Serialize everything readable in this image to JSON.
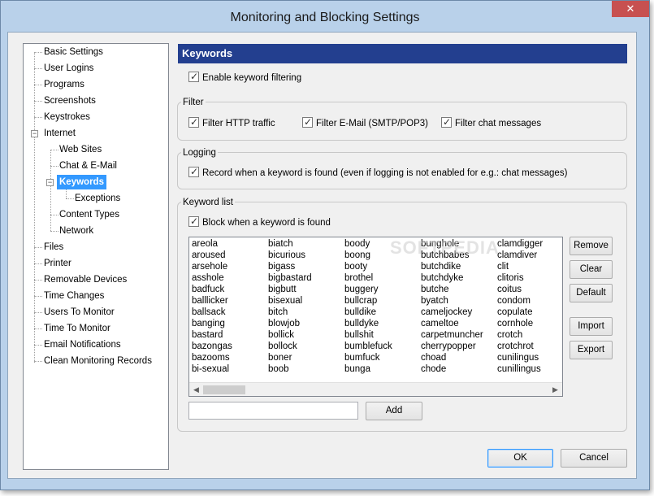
{
  "window": {
    "title": "Monitoring and Blocking Settings",
    "close_glyph": "✕"
  },
  "tree": {
    "items": [
      {
        "label": "Basic Settings"
      },
      {
        "label": "User Logins"
      },
      {
        "label": "Programs"
      },
      {
        "label": "Screenshots"
      },
      {
        "label": "Keystrokes"
      },
      {
        "label": "Internet"
      },
      {
        "label": "Web Sites"
      },
      {
        "label": "Chat & E-Mail"
      },
      {
        "label": "Keywords"
      },
      {
        "label": "Exceptions"
      },
      {
        "label": "Content Types"
      },
      {
        "label": "Network"
      },
      {
        "label": "Files"
      },
      {
        "label": "Printer"
      },
      {
        "label": "Removable Devices"
      },
      {
        "label": "Time Changes"
      },
      {
        "label": "Users To Monitor"
      },
      {
        "label": "Time To Monitor"
      },
      {
        "label": "Email Notifications"
      },
      {
        "label": "Clean Monitoring Records"
      }
    ]
  },
  "panel": {
    "header": "Keywords",
    "enable_filtering": "Enable keyword filtering",
    "filter_group": "Filter",
    "filter_http": "Filter HTTP traffic",
    "filter_email": "Filter E-Mail (SMTP/POP3)",
    "filter_chat": "Filter chat messages",
    "logging_group": "Logging",
    "record_keyword": "Record when a keyword is found (even if logging is not enabled for e.g.: chat messages)",
    "keyword_group": "Keyword list",
    "block_keyword": "Block when a keyword is found",
    "watermark": "SOFTPEDIA",
    "keywords": [
      [
        "areola",
        "aroused",
        "arsehole",
        "asshole",
        "badfuck",
        "balllicker",
        "ballsack",
        "banging",
        "bastard",
        "bazongas",
        "bazooms",
        "bi-sexual"
      ],
      [
        "biatch",
        "bicurious",
        "bigass",
        "bigbastard",
        "bigbutt",
        "bisexual",
        "bitch",
        "blowjob",
        "bollick",
        "bollock",
        "boner",
        "boob"
      ],
      [
        "boody",
        "boong",
        "booty",
        "brothel",
        "buggery",
        "bullcrap",
        "bulldike",
        "bulldyke",
        "bullshit",
        "bumblefuck",
        "bumfuck",
        "bunga"
      ],
      [
        "bunghole",
        "butchbabes",
        "butchdike",
        "butchdyke",
        "butche",
        "byatch",
        "cameljockey",
        "cameltoe",
        "carpetmuncher",
        "cherrypopper",
        "choad",
        "chode"
      ],
      [
        "clamdigger",
        "clamdiver",
        "clit",
        "clitoris",
        "coitus",
        "condom",
        "copulate",
        "cornhole",
        "crotch",
        "crotchrot",
        "cunilingus",
        "cunillingus"
      ]
    ],
    "buttons": {
      "remove": "Remove",
      "clear": "Clear",
      "default": "Default",
      "import": "Import",
      "export": "Export",
      "add": "Add"
    },
    "new_keyword_value": ""
  },
  "footer": {
    "ok": "OK",
    "cancel": "Cancel"
  }
}
